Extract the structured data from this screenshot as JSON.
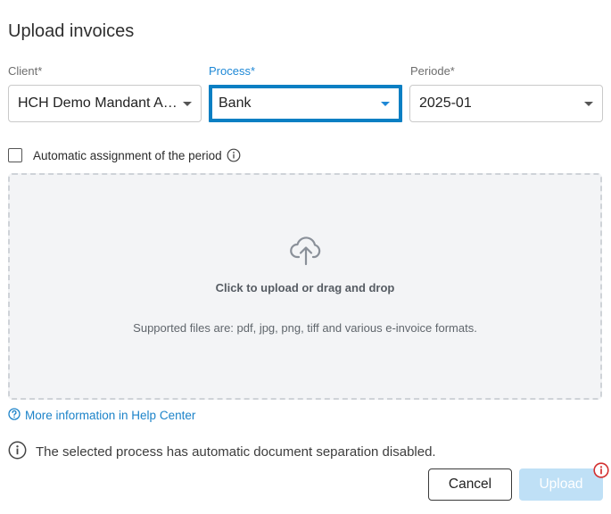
{
  "dialog": {
    "title": "Upload invoices"
  },
  "fields": {
    "client": {
      "label": "Client*",
      "value": "HCH Demo Mandant AG..."
    },
    "process": {
      "label": "Process*",
      "value": "Bank"
    },
    "periode": {
      "label": "Periode*",
      "value": "2025-01"
    }
  },
  "auto_assign": {
    "label": "Automatic assignment of the period",
    "checked": false
  },
  "dropzone": {
    "title": "Click to upload or drag and drop",
    "hint": "Supported files are: pdf, jpg, png, tiff and various e-invoice formats."
  },
  "help_link": {
    "label": "More information in Help Center"
  },
  "notice": {
    "text": "The selected process has automatic document separation disabled."
  },
  "buttons": {
    "cancel": "Cancel",
    "upload": "Upload",
    "upload_disabled": true
  },
  "colors": {
    "accent": "#0a7fc3",
    "link": "#1c83c9",
    "upload_disabled_bg": "#bfe0f6",
    "dropzone_bg": "#f3f4f6",
    "error": "#d32f2f"
  },
  "icons": {
    "info": "info-icon",
    "upload": "cloud-upload-icon",
    "help": "help-circle-icon",
    "alert": "alert-info-icon"
  }
}
